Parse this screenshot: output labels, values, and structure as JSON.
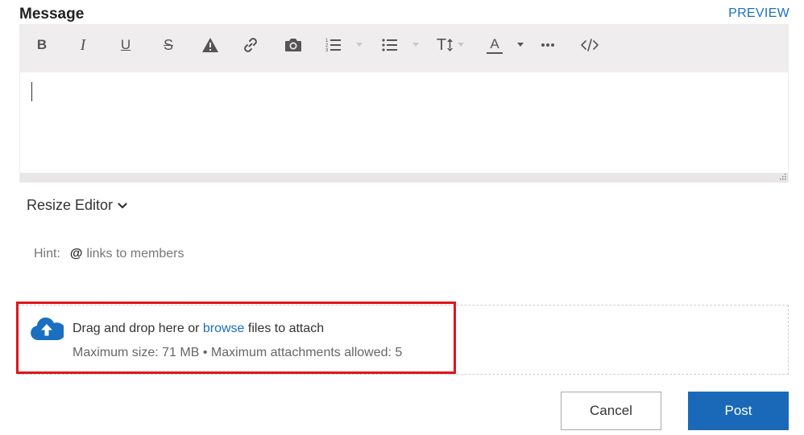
{
  "header": {
    "title": "Message",
    "preview_label": "PREVIEW"
  },
  "toolbar": {
    "buttons": [
      {
        "name": "bold",
        "icon": "bold-icon",
        "glyph": "B"
      },
      {
        "name": "italic",
        "icon": "italic-icon",
        "glyph": "I"
      },
      {
        "name": "underline",
        "icon": "underline-icon",
        "glyph": "U"
      },
      {
        "name": "strikethrough",
        "icon": "strikethrough-icon",
        "glyph": "S"
      },
      {
        "name": "spoiler",
        "icon": "warning-icon"
      },
      {
        "name": "link",
        "icon": "link-icon"
      },
      {
        "name": "image",
        "icon": "camera-icon"
      },
      {
        "name": "numbered-list",
        "icon": "numbered-list-icon",
        "has_dropdown": true
      },
      {
        "name": "bullet-list",
        "icon": "bullet-list-icon",
        "has_dropdown": true
      },
      {
        "name": "text-size",
        "icon": "text-size-icon",
        "glyph": "T",
        "has_dropdown": true
      },
      {
        "name": "text-color",
        "icon": "font-color-icon",
        "glyph": "A",
        "has_dropdown": true
      },
      {
        "name": "more",
        "icon": "more-icon"
      },
      {
        "name": "source-code",
        "icon": "code-icon"
      }
    ]
  },
  "editor": {
    "content": ""
  },
  "resize": {
    "label": "Resize Editor",
    "icon": "chevron-down-icon"
  },
  "hint": {
    "label": "Hint:",
    "at_symbol": "@",
    "text": "links to members"
  },
  "attachments": {
    "icon": "cloud-upload-icon",
    "drag_text_before": "Drag and drop here or ",
    "browse_label": "browse",
    "drag_text_after": " files to attach",
    "limits": "Maximum size: 71 MB • Maximum attachments allowed: 5"
  },
  "actions": {
    "cancel_label": "Cancel",
    "post_label": "Post"
  },
  "colors": {
    "accent": "#1a6fc1",
    "post_button": "#1a69b8",
    "highlight_box": "#e0151c",
    "toolbar_bg": "#efeded"
  }
}
